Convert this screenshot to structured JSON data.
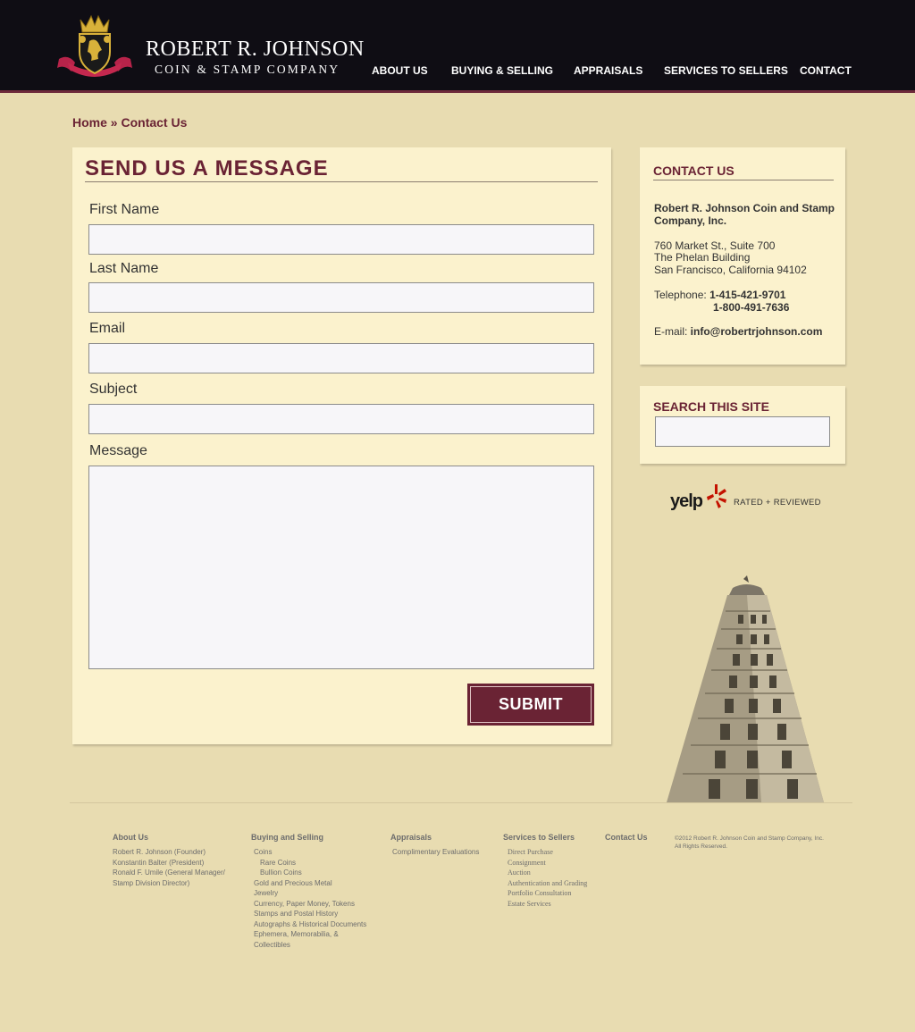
{
  "header": {
    "logo_name": "ROBERT R. JOHNSON",
    "logo_sub": "COIN & STAMP COMPANY",
    "nav": [
      "ABOUT US",
      "BUYING & SELLING",
      "APPRAISALS",
      "SERVICES TO SELLERS",
      "CONTACT"
    ]
  },
  "breadcrumb": {
    "home": "Home",
    "sep": " » ",
    "current": "Contact Us"
  },
  "form": {
    "title": "SEND US A MESSAGE",
    "fields": [
      "First Name",
      "Last Name",
      "Email",
      "Subject",
      "Message"
    ],
    "submit": "SUBMIT"
  },
  "contact": {
    "title": "CONTACT US",
    "company_1": "Robert R. Johnson Coin and Stamp",
    "company_2": "Company, Inc.",
    "address_1": "760 Market St., Suite 700",
    "address_2": "The Phelan Building",
    "address_3": "San Francisco, California 94102",
    "telephone_label": "Telephone: ",
    "phone_1": "1-415-421-9701",
    "phone_2": "1-800-491-7636",
    "email_label": "E-mail: ",
    "email": "info@robertrjohnson.com"
  },
  "search": {
    "title": "SEARCH THIS SITE"
  },
  "yelp": {
    "word": "yelp",
    "tag": "RATED + REVIEWED"
  },
  "footer": {
    "about": {
      "heading": "About Us",
      "items": [
        "Robert R. Johnson (Founder)",
        "Konstantin Balter (President)",
        "Ronald F. Umile  (General Manager/",
        "Stamp Division Director)"
      ]
    },
    "buying": {
      "heading": "Buying and Selling",
      "items": [
        "Coins",
        "Rare Coins",
        "Bullion Coins",
        "Gold and Precious Metal",
        "Jewelry",
        "Currency, Paper Money, Tokens",
        "Stamps and Postal History",
        "Autographs & Historical Documents",
        "Ephemera, Memorabilia, &",
        "Collectibles"
      ]
    },
    "appraisals": {
      "heading": "Appraisals",
      "items": [
        "Complimentary Evaluations"
      ]
    },
    "services": {
      "heading": "Services to Sellers",
      "items": [
        "Direct Purchase",
        "Consignment",
        "Auction",
        "Authentication and Grading",
        "Portfolio Consultation",
        "Estate Services"
      ]
    },
    "contact": {
      "heading": "Contact Us"
    },
    "copyright_1": "©2012 Robert R. Johnson Coin and Stamp Company, Inc.",
    "copyright_2": "All Rights Reserved."
  },
  "colors": {
    "header_bg": "#0f0d14",
    "accent": "#6a2334",
    "page_bg": "#e8dcb1",
    "panel_bg": "#fbf2cd"
  }
}
